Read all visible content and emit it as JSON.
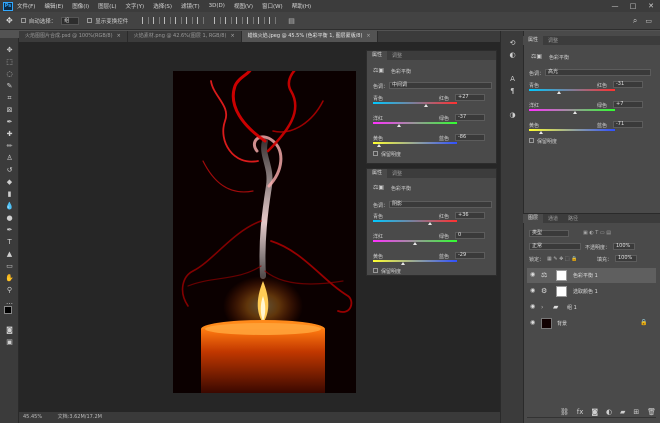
{
  "menubar": {
    "logo": "Ps",
    "items": [
      "文件(F)",
      "编辑(E)",
      "图像(I)",
      "图层(L)",
      "文字(Y)",
      "选择(S)",
      "滤镜(T)",
      "3D(D)",
      "视图(V)",
      "窗口(W)",
      "帮助(H)"
    ],
    "minimize": "—",
    "maximize": "□",
    "close": "✕"
  },
  "options": {
    "auto_select_label": "自动选择：",
    "auto_select_value": "组",
    "show_transform_label": "显示变换控件"
  },
  "tabs": [
    {
      "label": "火焰图图片合成.psd @ 100%(RGB/8)",
      "active": false
    },
    {
      "label": "火焰素材.png @ 42.6%(图层 1, RGB/8)",
      "active": false
    },
    {
      "label": "蜡烛火焰.jpeg @ 45.5% (色彩平衡 1, 图层蒙版/8)",
      "active": true
    }
  ],
  "status": {
    "zoom": "45.45%",
    "doc": "文档:3.62M/17.2M"
  },
  "panel1": {
    "tab_props": "属性",
    "tab_adjust": "调整",
    "title": "色彩平衡",
    "tone_label": "色调：",
    "tone_value": "中间调",
    "sliders": [
      {
        "left": "青色",
        "right": "红色",
        "value": "+27",
        "pos": 0.635
      },
      {
        "left": "洋红",
        "right": "绿色",
        "value": "-37",
        "pos": 0.315
      },
      {
        "left": "黄色",
        "right": "蓝色",
        "value": "-86",
        "pos": 0.07
      }
    ],
    "preserve": "保留明度"
  },
  "panel2": {
    "tab_props": "属性",
    "tab_adjust": "调整",
    "title": "色彩平衡",
    "tone_label": "色调：",
    "tone_value": "阴影",
    "sliders": [
      {
        "left": "青色",
        "right": "红色",
        "value": "+36",
        "pos": 0.68
      },
      {
        "left": "洋红",
        "right": "绿色",
        "value": "0",
        "pos": 0.5
      },
      {
        "left": "黄色",
        "right": "蓝色",
        "value": "-29",
        "pos": 0.355
      }
    ],
    "preserve": "保留明度"
  },
  "panel3": {
    "tab_props": "属性",
    "tab_adjust": "调整",
    "title": "色彩平衡",
    "tone_label": "色调：",
    "tone_value": "高光",
    "sliders": [
      {
        "left": "青色",
        "right": "红色",
        "value": "-31",
        "pos": 0.345
      },
      {
        "left": "洋红",
        "right": "绿色",
        "value": "+7",
        "pos": 0.535
      },
      {
        "left": "黄色",
        "right": "蓝色",
        "value": "-71",
        "pos": 0.145
      }
    ],
    "preserve": "保留明度"
  },
  "layers": {
    "tab_layers": "图层",
    "tab_channels": "通道",
    "tab_paths": "路径",
    "filter_label": "类型",
    "blend_mode": "正常",
    "opacity_label": "不透明度：",
    "opacity_value": "100%",
    "lock_label": "锁定：",
    "fill_label": "填充：",
    "fill_value": "100%",
    "items": [
      {
        "name": "色彩平衡 1",
        "selected": true
      },
      {
        "name": "选取颜色 1",
        "selected": false
      },
      {
        "name": "组 1",
        "selected": false
      },
      {
        "name": "背景",
        "selected": false
      }
    ]
  }
}
